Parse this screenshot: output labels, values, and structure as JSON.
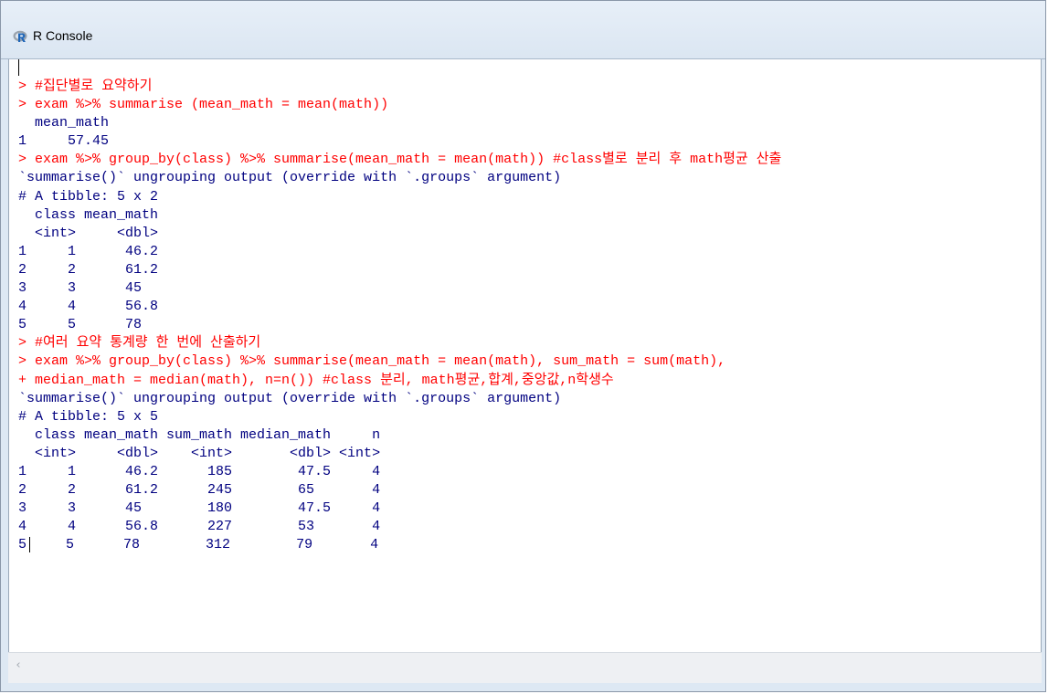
{
  "window": {
    "title": "R Console",
    "icon": "r-logo-icon"
  },
  "console": {
    "lines": [
      {
        "kind": "input",
        "text": "> #집단별로 요약하기"
      },
      {
        "kind": "input",
        "text": "> exam %>% summarise (mean_math = mean(math))"
      },
      {
        "kind": "output",
        "text": "  mean_math"
      },
      {
        "kind": "output",
        "text": "1     57.45"
      },
      {
        "kind": "input",
        "text": "> exam %>% group_by(class) %>% summarise(mean_math = mean(math)) #class별로 분리 후 math평균 산출"
      },
      {
        "kind": "output",
        "text": "`summarise()` ungrouping output (override with `.groups` argument)"
      },
      {
        "kind": "output",
        "text": "# A tibble: 5 x 2"
      },
      {
        "kind": "output",
        "text": "  class mean_math"
      },
      {
        "kind": "output",
        "text": "  <int>     <dbl>"
      },
      {
        "kind": "output",
        "text": "1     1      46.2"
      },
      {
        "kind": "output",
        "text": "2     2      61.2"
      },
      {
        "kind": "output",
        "text": "3     3      45"
      },
      {
        "kind": "output",
        "text": "4     4      56.8"
      },
      {
        "kind": "output",
        "text": "5     5      78"
      },
      {
        "kind": "input",
        "text": "> #여러 요약 통계량 한 번에 산출하기"
      },
      {
        "kind": "input",
        "text": "> exam %>% group_by(class) %>% summarise(mean_math = mean(math), sum_math = sum(math),"
      },
      {
        "kind": "input",
        "text": "+ median_math = median(math), n=n()) #class 분리, math평균,합계,중앙값,n학생수"
      },
      {
        "kind": "output",
        "text": "`summarise()` ungrouping output (override with `.groups` argument)"
      },
      {
        "kind": "output",
        "text": "# A tibble: 5 x 5"
      },
      {
        "kind": "output",
        "text": "  class mean_math sum_math median_math     n"
      },
      {
        "kind": "output",
        "text": "  <int>     <dbl>    <int>       <dbl> <int>"
      },
      {
        "kind": "output",
        "text": "1     1      46.2      185        47.5     4"
      },
      {
        "kind": "output",
        "text": "2     2      61.2      245        65       4"
      },
      {
        "kind": "output",
        "text": "3     3      45        180        47.5     4"
      },
      {
        "kind": "output",
        "text": "4     4      56.8      227        53       4"
      },
      {
        "kind": "output-caret",
        "prefix": "5",
        "text": "    5      78        312        79       4"
      }
    ]
  },
  "scrollbar": {
    "left_arrow": "‹"
  },
  "colors": {
    "input": "#ff0000",
    "output": "#000080"
  }
}
